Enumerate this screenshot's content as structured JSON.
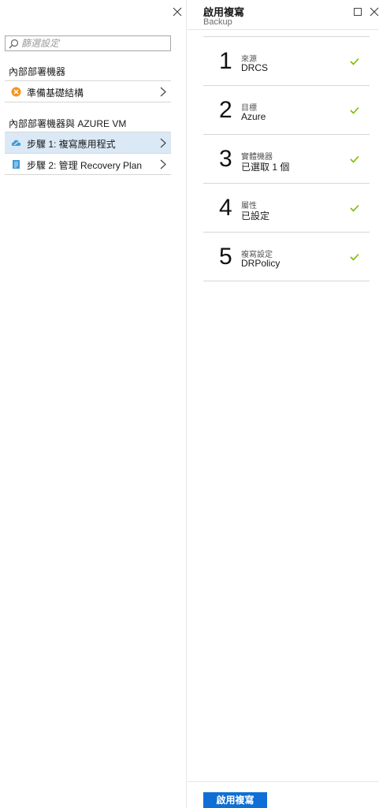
{
  "left_panel": {
    "search": {
      "placeholder": "篩選設定",
      "value": ""
    },
    "sections": [
      {
        "title": "內部部署機器",
        "items": [
          {
            "label": "準備基礎結構",
            "icon": "warning-icon",
            "active": false
          }
        ]
      },
      {
        "title": "內部部署機器與 AZURE VM",
        "items": [
          {
            "label": "步驟 1: 複寫應用程式",
            "icon": "cloud-icon",
            "active": true
          },
          {
            "label": "步驟 2: 管理 Recovery Plan",
            "icon": "document-icon",
            "active": false
          }
        ]
      }
    ]
  },
  "right_panel": {
    "title": "啟用複寫",
    "subtitle": "Backup",
    "steps": [
      {
        "number": "1",
        "caption": "來源",
        "value": "DRCS",
        "status": "complete"
      },
      {
        "number": "2",
        "caption": "目標",
        "value": "Azure",
        "status": "complete"
      },
      {
        "number": "3",
        "caption": "實體機器",
        "value": "已選取 1 個",
        "status": "complete"
      },
      {
        "number": "4",
        "caption": "屬性",
        "value": "已設定",
        "status": "complete"
      },
      {
        "number": "5",
        "caption": "複寫設定",
        "value": "DRPolicy",
        "status": "complete"
      }
    ],
    "primary_button": "啟用複寫"
  },
  "colors": {
    "accent": "#0f6fd4",
    "active_row": "#dbe9f7",
    "check": "#7fba00",
    "warning": "#f7931e",
    "cloud": "#3e9bd6"
  }
}
